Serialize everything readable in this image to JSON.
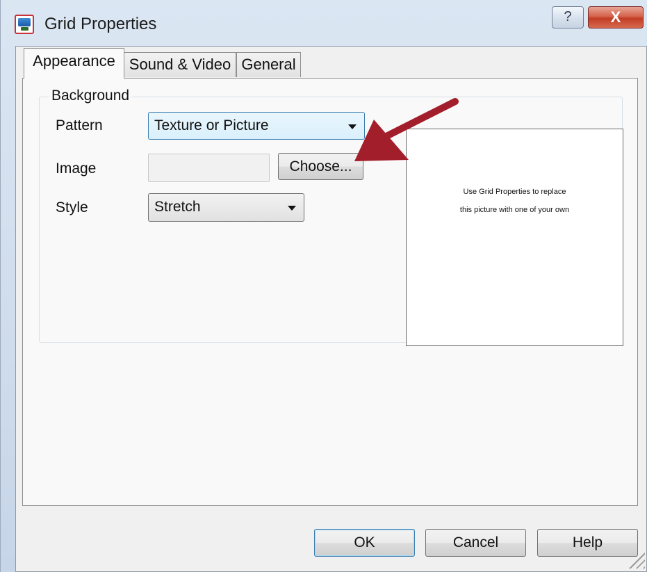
{
  "window": {
    "title": "Grid Properties",
    "help_glyph": "?",
    "close_glyph": "X"
  },
  "tabs": [
    {
      "label": "Appearance",
      "active": true
    },
    {
      "label": "Sound & Video",
      "active": false
    },
    {
      "label": "General",
      "active": false
    }
  ],
  "background_group": {
    "label": "Background",
    "pattern": {
      "label": "Pattern",
      "value": "Texture or Picture"
    },
    "image": {
      "label": "Image",
      "value": "",
      "choose_label": "Choose..."
    },
    "style": {
      "label": "Style",
      "value": "Stretch"
    },
    "preview": {
      "line1": "Use Grid Properties to replace",
      "line2": "this picture with one of your own"
    }
  },
  "footer": {
    "ok_label": "OK",
    "cancel_label": "Cancel",
    "help_label": "Help"
  },
  "colors": {
    "annotation_arrow": "#a31e2b",
    "close_button": "#c13d25",
    "focus_border": "#3c7fb1"
  },
  "icons": {
    "app": "grid-app-icon",
    "dropdown": "chevron-down-icon",
    "help": "question-icon",
    "close": "close-icon"
  }
}
